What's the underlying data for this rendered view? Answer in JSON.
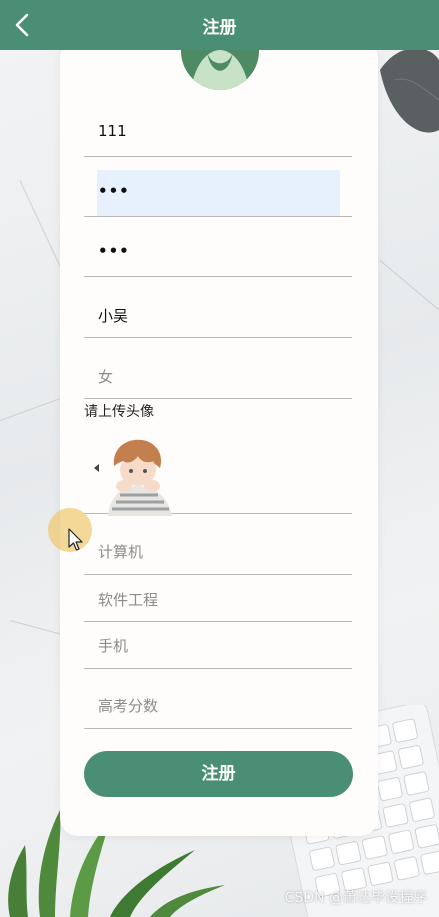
{
  "header": {
    "title": "注册"
  },
  "form": {
    "username": "111",
    "password_dots": "•••",
    "confirm_dots": "•••",
    "name": "小吴",
    "gender_placeholder": "女",
    "upload_label": "请上传头像",
    "major_placeholder": "计算机",
    "department_placeholder": "软件工程",
    "phone_placeholder": "手机",
    "score_placeholder": "高考分数",
    "submit_label": "注册"
  },
  "watermark": "CSDN @萧达毕设程序",
  "colors": {
    "primary": "#4a8f75",
    "card": "#fefdfb",
    "highlight": "#e7f0fd"
  },
  "icons": {
    "back": "chevron-left-icon",
    "avatar": "person-avatar-icon"
  }
}
